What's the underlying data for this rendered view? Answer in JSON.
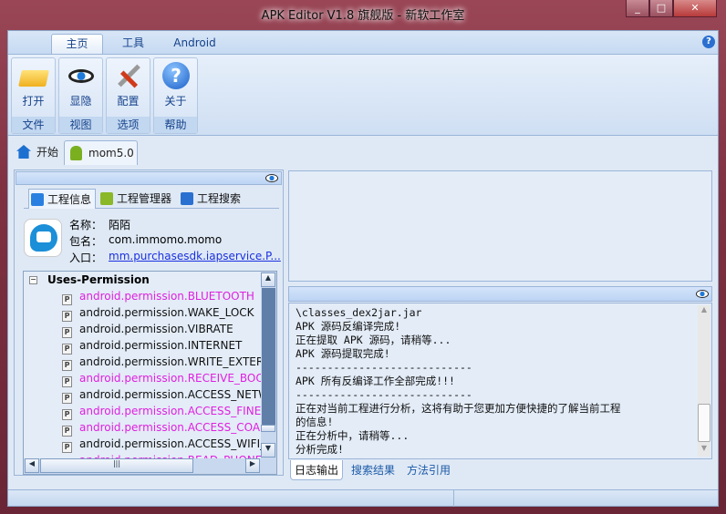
{
  "window": {
    "title": "APK Editor V1.8 旗舰版 - 新软工作室",
    "controls": [
      "_",
      "□",
      "✕"
    ]
  },
  "ribbon": {
    "tabs": [
      "主页",
      "工具",
      "Android"
    ],
    "help": "?",
    "groups": [
      {
        "button": "打开",
        "label": "文件",
        "icon": "folder-icon"
      },
      {
        "button": "显隐",
        "label": "视图",
        "icon": "eye-icon"
      },
      {
        "button": "配置",
        "label": "选项",
        "icon": "tools-icon"
      },
      {
        "button": "关于",
        "label": "帮助",
        "icon": "help-icon"
      }
    ]
  },
  "doc_tabs": [
    "开始",
    "mom5.0"
  ],
  "left": {
    "tabs": [
      "工程信息",
      "工程管理器",
      "工程搜索"
    ],
    "info": {
      "name_label": "名称：",
      "name": "陌陌",
      "package_label": "包名：",
      "package": "com.immomo.momo",
      "entry_label": "入口：",
      "entry": "mm.purchasesdk.iapservice.P..."
    },
    "tree": {
      "root": "Uses-Permission",
      "items": [
        {
          "text": "android.permission.BLUETOOTH",
          "highlight": true
        },
        {
          "text": "android.permission.WAKE_LOCK",
          "highlight": false
        },
        {
          "text": "android.permission.VIBRATE",
          "highlight": false
        },
        {
          "text": "android.permission.INTERNET",
          "highlight": false
        },
        {
          "text": "android.permission.WRITE_EXTERI",
          "highlight": false
        },
        {
          "text": "android.permission.RECEIVE_BOO",
          "highlight": true
        },
        {
          "text": "android.permission.ACCESS_NETW",
          "highlight": false
        },
        {
          "text": "android.permission.ACCESS_FINE_",
          "highlight": true
        },
        {
          "text": "android.permission.ACCESS_COAR",
          "highlight": true
        },
        {
          "text": "android.permission.ACCESS_WIFI_",
          "highlight": false
        },
        {
          "text": "android.permission.READ_PHONE",
          "highlight": true
        }
      ]
    }
  },
  "log": {
    "lines": [
      "\\classes_dex2jar.jar",
      "APK 源码反编译完成!",
      "正在提取 APK 源码，请稍等...",
      "APK 源码提取完成!",
      "----------------------------",
      "APK 所有反编译工作全部完成!!!",
      "----------------------------",
      "正在对当前工程进行分析，这将有助于您更加方便快捷的了解当前工程",
      "的信息!",
      "正在分析中，请稍等...",
      "分析完成!"
    ],
    "tabs": [
      "日志输出",
      "搜索结果",
      "方法引用"
    ]
  },
  "colors": {
    "highlight": "#e020e0",
    "accent": "#15428b"
  }
}
